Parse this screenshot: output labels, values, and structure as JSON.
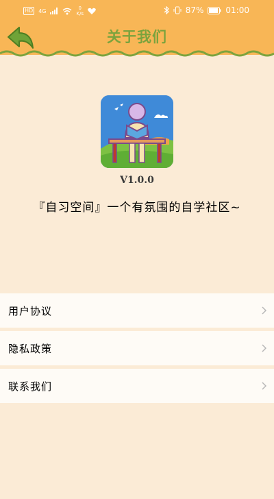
{
  "status_bar": {
    "hd": "HD",
    "signal": "4G",
    "speed_value": "0",
    "speed_unit": "K/s",
    "battery": "87%",
    "time": "01:00"
  },
  "header": {
    "title": "关于我们",
    "back_icon": "back-arrow-icon"
  },
  "about": {
    "version": "V1.0.0",
    "slogan": "『自习空间』一个有氛围的自学社区~"
  },
  "menu": [
    {
      "label": "用户协议"
    },
    {
      "label": "隐私政策"
    },
    {
      "label": "联系我们"
    }
  ],
  "colors": {
    "header": "#F8B656",
    "title": "#7BA33D",
    "background": "#FBEBD6",
    "item_bg": "#FEFBF6"
  }
}
